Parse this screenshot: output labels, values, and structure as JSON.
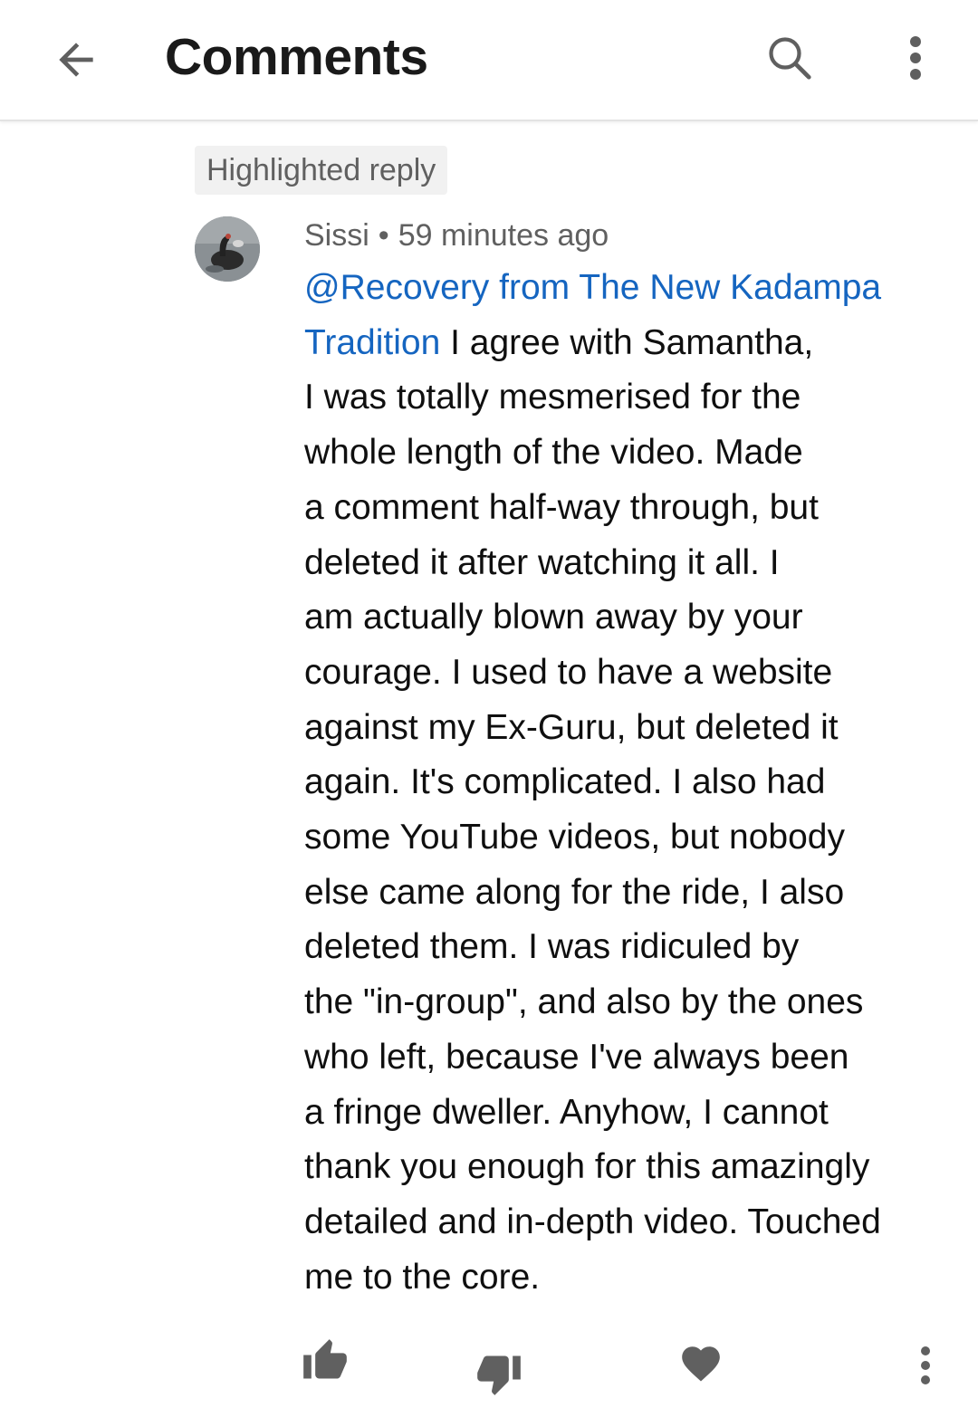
{
  "header": {
    "back_icon": "arrow-left-icon",
    "title": "Comments",
    "search_icon": "search-icon",
    "menu_icon": "more-vert-icon"
  },
  "comment": {
    "badge": "Highlighted reply",
    "avatar_icon": "avatar-image",
    "author": "Sissi",
    "separator": "•",
    "timestamp": "59 minutes ago",
    "mention_line1": "@Recovery from The New Kadampa",
    "mention_line2": "Tradition",
    "lines": [
      " I agree with Samantha,",
      "I was totally mesmerised for the",
      "whole length of the video. Made",
      "a comment half-way through, but",
      "deleted it after watching it all. I",
      "am actually blown away by your",
      "courage. I used to have a website",
      "against my Ex-Guru, but deleted it",
      "again. It's complicated. I also had",
      "some YouTube videos, but nobody",
      "else came along for the ride, I also",
      "deleted them. I was ridiculed by",
      "the \"in-group\", and also by the ones",
      "who left, because I've always been",
      "a fringe dweller. Anyhow, I cannot",
      "thank you enough for this amazingly",
      "detailed and in-depth video. Touched",
      "me to the core."
    ]
  },
  "actions": {
    "like_icon": "thumb-up-icon",
    "dislike_icon": "thumb-down-icon",
    "heart_icon": "heart-icon",
    "more_icon": "more-vert-icon"
  },
  "colors": {
    "mention": "#1565c0",
    "text": "#0f0f0f",
    "secondary_text": "#606060",
    "icon": "#606060",
    "badge_bg": "#f1f1f1"
  }
}
